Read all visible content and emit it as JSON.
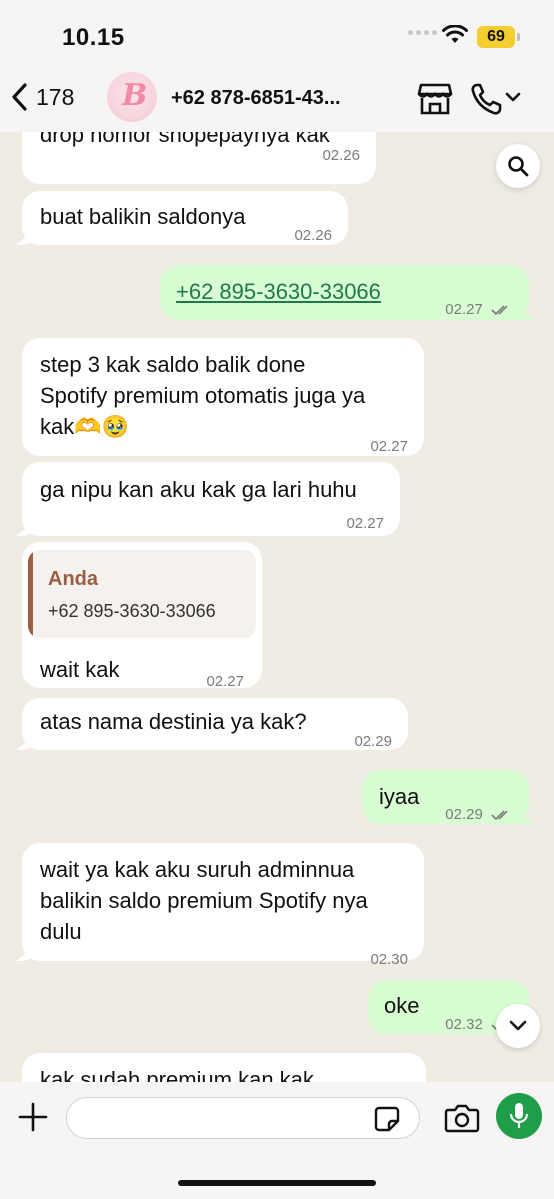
{
  "status_bar": {
    "time": "10.15",
    "battery": "69"
  },
  "header": {
    "back_count": "178",
    "avatar_letter": "B",
    "contact_name": "+62 878-6851-43..."
  },
  "messages": [
    {
      "dir": "in",
      "text": "drop nomor shopepaynya kak",
      "time": "02.26"
    },
    {
      "dir": "in",
      "text": "buat balikin saldonya",
      "time": "02.26"
    },
    {
      "dir": "out",
      "text": "+62 895-3630-33066",
      "time": "02.27",
      "link": true
    },
    {
      "dir": "in",
      "lines": [
        "step 3 kak saldo balik done",
        "Spotify premium otomatis juga ya",
        "kak🫶🥹"
      ],
      "time": "02.27"
    },
    {
      "dir": "in",
      "text": "ga nipu kan aku kak ga lari huhu",
      "time": "02.27"
    },
    {
      "dir": "in",
      "reply": {
        "name": "Anda",
        "text": "+62 895-3630-33066"
      },
      "text": "wait kak",
      "time": "02.27"
    },
    {
      "dir": "in",
      "text": "atas nama destinia ya kak?",
      "time": "02.29"
    },
    {
      "dir": "out",
      "text": "iyaa",
      "time": "02.29"
    },
    {
      "dir": "in",
      "lines": [
        "wait ya kak aku suruh adminnua",
        "balikin saldo premium Spotify nya",
        "dulu"
      ],
      "time": "02.30"
    },
    {
      "dir": "out",
      "text": "oke",
      "time": "02.32"
    },
    {
      "dir": "in",
      "text": "kak sudah premium kan kak",
      "time": ""
    }
  ],
  "input": {
    "placeholder": ""
  },
  "colors": {
    "incoming": "#ffffff",
    "outgoing": "#d8fdd2",
    "link": "#1f7a45",
    "accent": "#1f9e4a",
    "chat_bg": "#f0ece4"
  }
}
